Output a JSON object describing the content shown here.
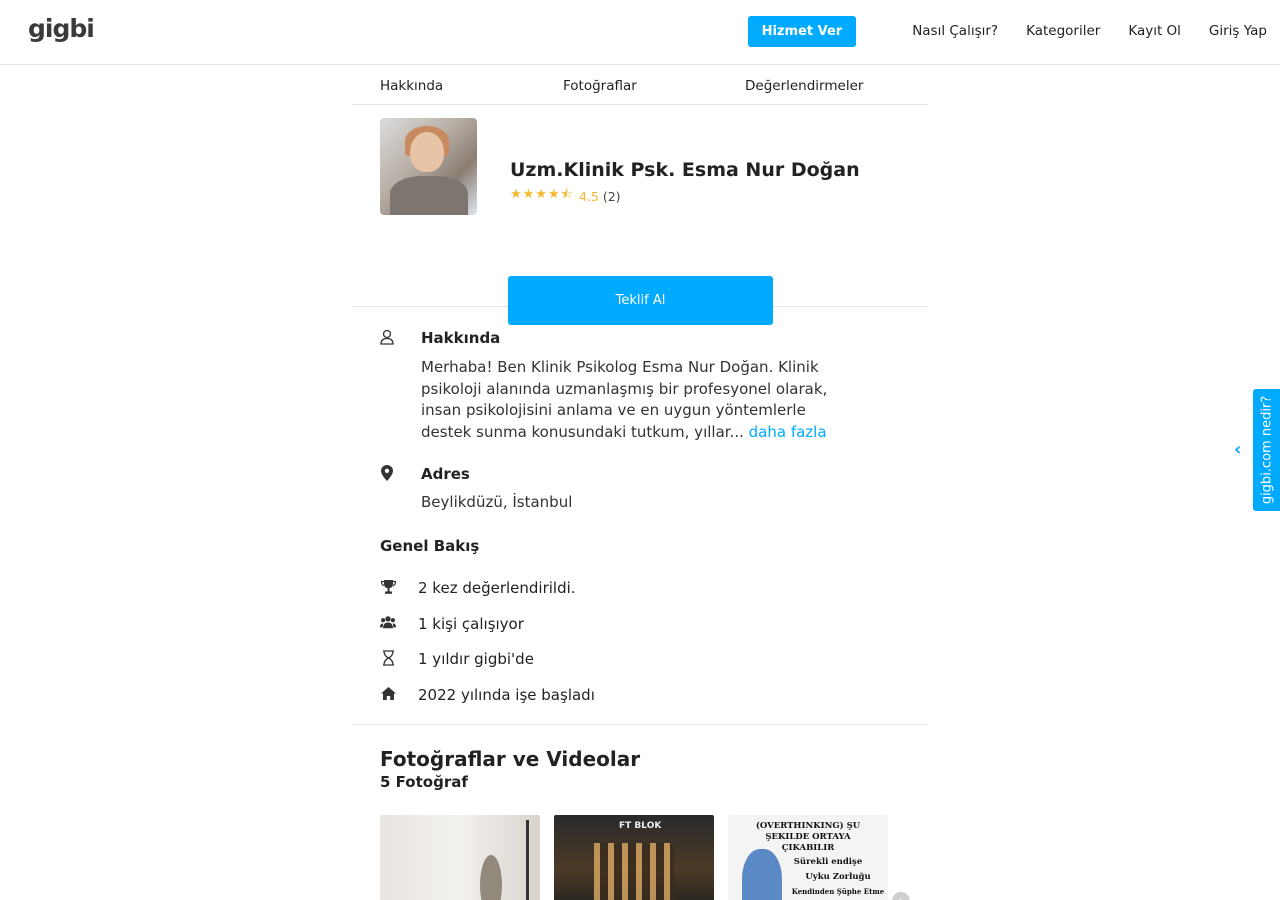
{
  "header": {
    "logo": "gigbi",
    "cta_label": "Hizmet Ver",
    "nav": [
      "Nasıl Çalışır?",
      "Kategoriler",
      "Kayıt Ol",
      "Giriş Yap"
    ]
  },
  "tabs": [
    "Hakkında",
    "Fotoğraflar",
    "Değerlendirmeler"
  ],
  "profile": {
    "name": "Uzm.Klinik Psk. Esma Nur Doğan",
    "stars_display": "★★★★⯪",
    "rating": 4.5,
    "score_text": "4.5",
    "count_text": "(2)",
    "cta_label": "Teklif Al"
  },
  "about": {
    "title": "Hakkında",
    "text": "Merhaba! Ben Klinik Psikolog Esma Nur Doğan. Klinik psikoloji alanında uzmanlaşmış bir profesyonel olarak, insan psikolojisini anlama ve en uygun yöntemlerle destek sunma konusundaki tutkum, yıllar...",
    "more_label": "daha fazla"
  },
  "address": {
    "title": "Adres",
    "value": "Beylikdüzü, İstanbul"
  },
  "overview": {
    "title": "Genel Bakış",
    "items": [
      {
        "icon": "trophy-icon",
        "text": "2 kez değerlendirildi."
      },
      {
        "icon": "users-icon",
        "text": "1 kişi çalışıyor"
      },
      {
        "icon": "hourglass-icon",
        "text": "1 yıldır gigbi'de"
      },
      {
        "icon": "home-icon",
        "text": "2022 yılında işe başladı"
      }
    ]
  },
  "photos": {
    "title": "Fotoğraflar ve Videolar",
    "subtitle": "5 Fotoğraf",
    "thumb2_sign": "FT BLOK",
    "thumb3_lines": [
      "(OVERTHINKING) ŞU",
      "ŞEKILDE ORTAYA",
      "ÇIKABILIR",
      "Sürekli endişe",
      "Uyku Zorluğu",
      "Kendinden Şüphe Etme"
    ]
  },
  "side_tab": {
    "label": "gigbi.com nedir?"
  },
  "colors": {
    "accent": "#00aaff",
    "star": "#f5b82e"
  }
}
